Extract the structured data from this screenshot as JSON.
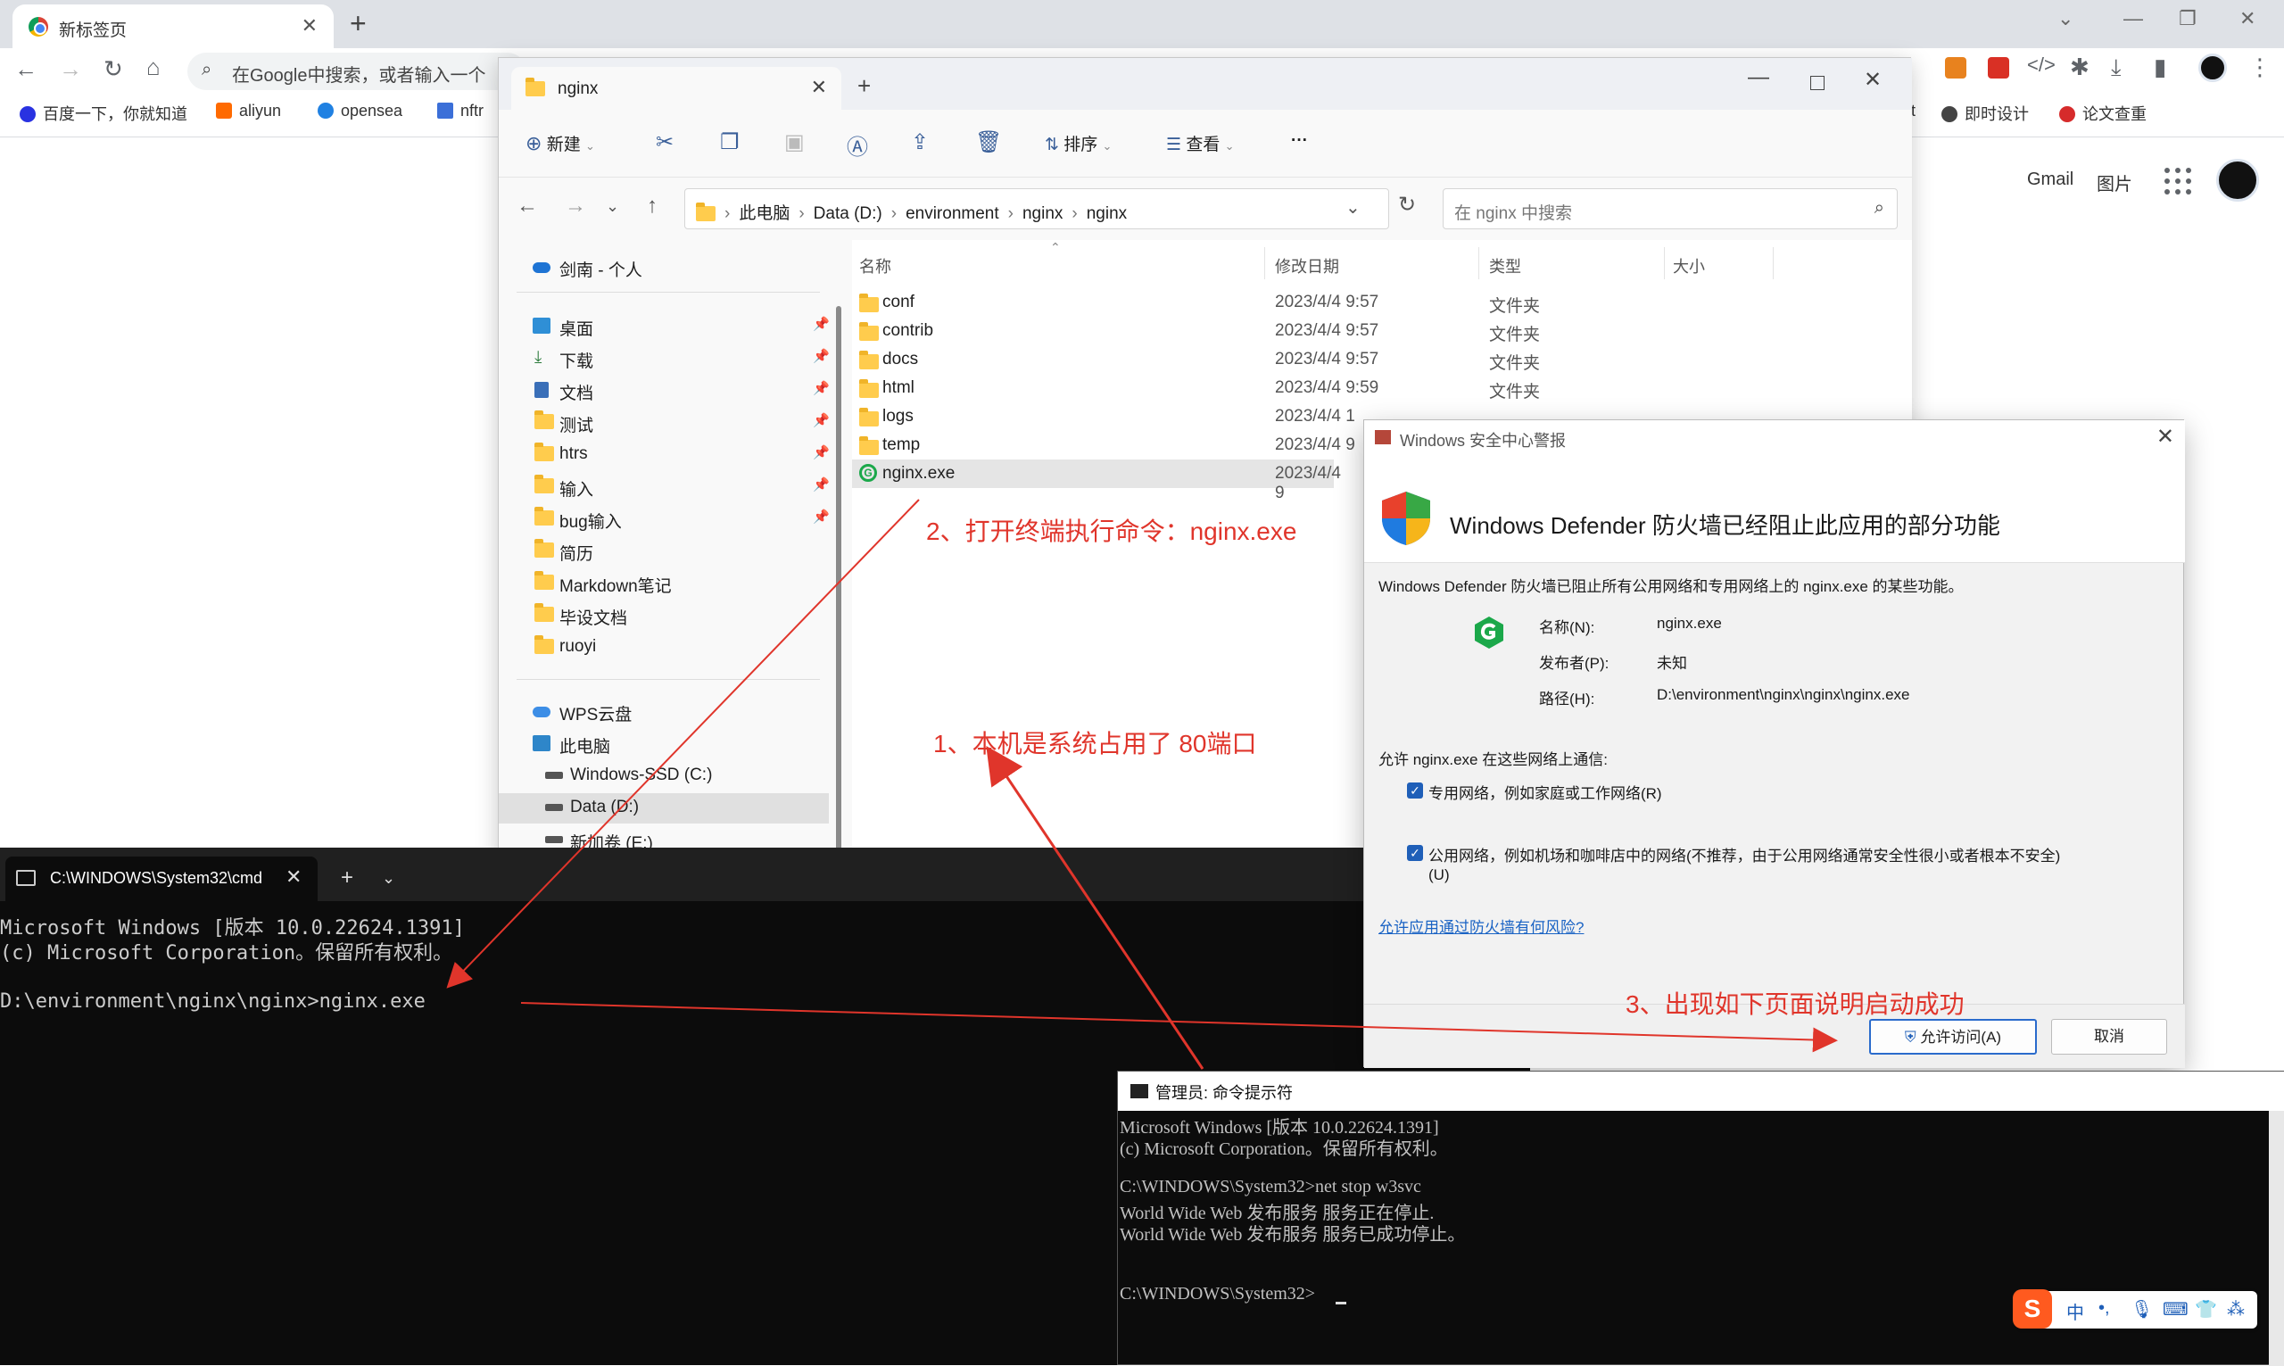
{
  "browser": {
    "tab_title": "新标签页",
    "omnibox_placeholder": "在Google中搜索，或者输入一个",
    "bookmarks": [
      "百度一下，你就知道",
      "aliyun",
      "opensea",
      "nftr",
      "t",
      "即时设计",
      "论文查重"
    ],
    "top_links": [
      "Gmail",
      "图片"
    ]
  },
  "explorer": {
    "tab_title": "nginx",
    "commands": {
      "new": "新建",
      "sort": "排序",
      "view": "查看",
      "more": "···"
    },
    "breadcrumbs": [
      "此电脑",
      "Data (D:)",
      "environment",
      "nginx",
      "nginx"
    ],
    "search_placeholder": "在 nginx 中搜索",
    "sidebar": {
      "onedrive": "剑南 - 个人",
      "pinned": [
        "桌面",
        "下载",
        "文档",
        "测试",
        "htrs",
        "输入",
        "bug输入"
      ],
      "folders": [
        "简历",
        "Markdown笔记",
        "毕设文档",
        "ruoyi"
      ],
      "wps": "WPS云盘",
      "this_pc": "此电脑",
      "drives": [
        "Windows-SSD (C:)",
        "Data (D:)",
        "新加卷 (E:)"
      ]
    },
    "columns": {
      "name": "名称",
      "date": "修改日期",
      "type": "类型",
      "size": "大小"
    },
    "files": [
      {
        "name": "conf",
        "date": "2023/4/4 9:57",
        "type": "文件夹"
      },
      {
        "name": "contrib",
        "date": "2023/4/4 9:57",
        "type": "文件夹"
      },
      {
        "name": "docs",
        "date": "2023/4/4 9:57",
        "type": "文件夹"
      },
      {
        "name": "html",
        "date": "2023/4/4 9:59",
        "type": "文件夹"
      },
      {
        "name": "logs",
        "date": "2023/4/4 1",
        "type": ""
      },
      {
        "name": "temp",
        "date": "2023/4/4 9",
        "type": ""
      },
      {
        "name": "nginx.exe",
        "date": "2023/4/4 9",
        "type": ""
      }
    ]
  },
  "defender": {
    "title": "Windows 安全中心警报",
    "heading": "Windows Defender 防火墙已经阻止此应用的部分功能",
    "desc": "Windows Defender 防火墙已阻止所有公用网络和专用网络上的 nginx.exe 的某些功能。",
    "name_label": "名称(N):",
    "name_value": "nginx.exe",
    "publisher_label": "发布者(P):",
    "publisher_value": "未知",
    "path_label": "路径(H):",
    "path_value": "D:\\environment\\nginx\\nginx\\nginx.exe",
    "allow_prompt": "允许 nginx.exe 在这些网络上通信:",
    "private_net": "专用网络，例如家庭或工作网络(R)",
    "public_net": "公用网络，例如机场和咖啡店中的网络(不推荐，由于公用网络通常安全性很小或者根本不安全)",
    "public_net_key": "(U)",
    "risk_link": "允许应用通过防火墙有何风险?",
    "allow_button": "允许访问(A)",
    "cancel_button": "取消"
  },
  "terminal1": {
    "tab_title": "C:\\WINDOWS\\System32\\cmd",
    "lines": [
      "Microsoft Windows [版本 10.0.22624.1391]",
      "(c) Microsoft Corporation。保留所有权利。",
      "",
      "D:\\environment\\nginx\\nginx>nginx.exe"
    ]
  },
  "terminal2": {
    "title": "管理员: 命令提示符",
    "lines": [
      "Microsoft Windows [版本 10.0.22624.1391]",
      "(c) Microsoft Corporation。保留所有权利。",
      "",
      "C:\\WINDOWS\\System32>net stop w3svc",
      "World Wide Web 发布服务 服务正在停止.",
      "World Wide Web 发布服务 服务已成功停止。",
      "",
      "",
      "C:\\WINDOWS\\System32>"
    ]
  },
  "annotations": {
    "step1": "1、本机是系统占用了 80端口",
    "step2": "2、打开终端执行命令：nginx.exe",
    "step3": "3、出现如下页面说明启动成功"
  },
  "ime": {
    "logo": "S",
    "mode": "中",
    "punct": "•,"
  },
  "colors": {
    "annotation": "#e0352b",
    "link": "#1a63c4",
    "accent": "#1f5fb8"
  }
}
